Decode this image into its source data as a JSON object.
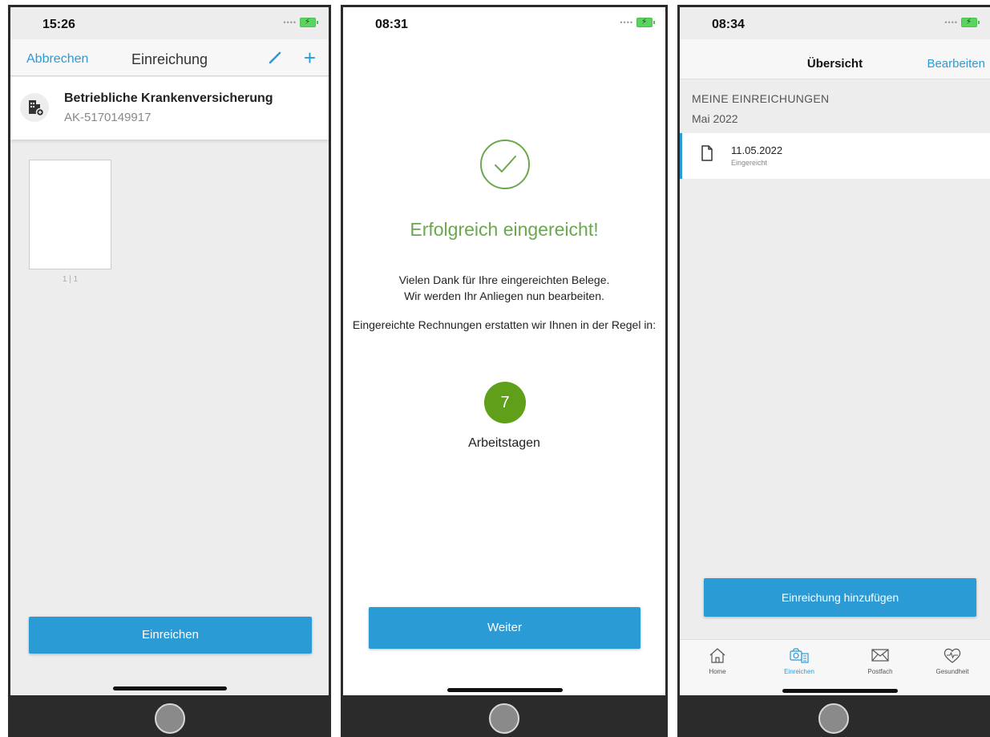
{
  "colors": {
    "accent": "#2b9bd6",
    "success": "#6aa84f",
    "days_badge": "#5f9f1a"
  },
  "phone1": {
    "time": "15:26",
    "nav": {
      "cancel": "Abbrechen",
      "title": "Einreichung"
    },
    "insurer": {
      "name": "Betriebliche Krankenversicherung",
      "code": "AK-5170149917"
    },
    "page_counter": "1 | 1",
    "submit_label": "Einreichen"
  },
  "phone2": {
    "time": "08:31",
    "title": "Erfolgreich eingereicht!",
    "thanks_line1": "Vielen Dank für Ihre eingereichten Belege.",
    "thanks_line2": "Wir werden Ihr Anliegen nun bearbeiten.",
    "refund_line": "Eingereichte Rechnungen erstatten wir Ihnen in der Regel in:",
    "days": "7",
    "days_label": "Arbeitstagen",
    "continue_label": "Weiter"
  },
  "phone3": {
    "time": "08:34",
    "nav": {
      "title": "Übersicht",
      "edit": "Bearbeiten"
    },
    "section_header": "MEINE EINREICHUNGEN",
    "month": "Mai 2022",
    "entry": {
      "date": "11.05.2022",
      "status": "Eingereicht"
    },
    "add_label": "Einreichung hinzufügen",
    "tabs": [
      {
        "label": "Home",
        "icon": "home-icon"
      },
      {
        "label": "Einreichen",
        "icon": "camera-document-icon"
      },
      {
        "label": "Postfach",
        "icon": "envelope-icon"
      },
      {
        "label": "Gesundheit",
        "icon": "heart-pulse-icon"
      }
    ]
  }
}
